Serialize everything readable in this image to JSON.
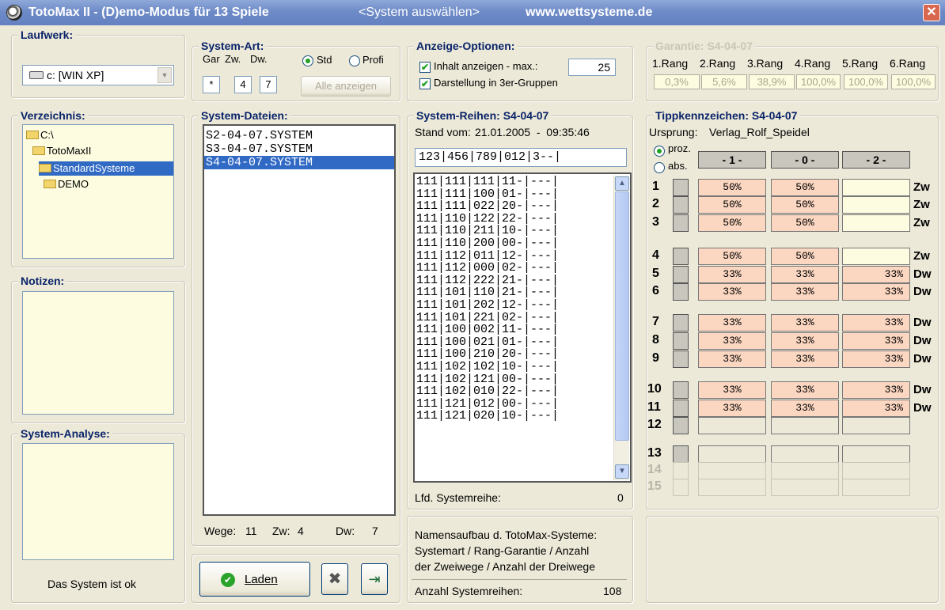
{
  "window": {
    "title": "TotoMax II - (D)emo-Modus für 13 Spiele",
    "system_prompt": "<System auswählen>",
    "website": "www.wettsysteme.de",
    "close": "✕"
  },
  "laufwerk": {
    "legend": "Laufwerk:",
    "drive": "c: [WIN XP]"
  },
  "verzeichnis": {
    "legend": "Verzeichnis:",
    "items": [
      "C:\\",
      "TotoMaxII",
      "StandardSysteme",
      "DEMO"
    ]
  },
  "notizen": {
    "legend": "Notizen:"
  },
  "analyse": {
    "legend": "System-Analyse:",
    "status": "Das System ist ok"
  },
  "system_art": {
    "legend": "System-Art:",
    "col_gar": "Gar",
    "col_zw": "Zw.",
    "col_dw": "Dw.",
    "gar_value": "*",
    "zw_value": "4",
    "dw_value": "7",
    "radio_std": "Std",
    "radio_profi": "Profi",
    "alle_button": "Alle anzeigen"
  },
  "dateien": {
    "legend": "System-Dateien:",
    "files": [
      "S2-04-07.SYSTEM",
      "S3-04-07.SYSTEM",
      "S4-04-07.SYSTEM"
    ],
    "wege_label": "Wege:",
    "wege": "11",
    "zw_label": "Zw:",
    "zw": "4",
    "dw_label": "Dw:",
    "dw": "7"
  },
  "buttons": {
    "laden": "Laden"
  },
  "anzeige": {
    "legend": "Anzeige-Optionen:",
    "inhalt_label": "Inhalt anzeigen - max.:",
    "max_value": "25",
    "gruppen_label": "Darstellung in 3er-Gruppen"
  },
  "reihen": {
    "legend": "System-Reihen: S4-04-07",
    "stand_label": "Stand vom:",
    "stand_value": "21.01.2005  -  09:35:46",
    "header": "123|456|789|012|3--|",
    "rows": [
      "111|111|111|11-|---|",
      "111|111|100|01-|---|",
      "111|111|022|20-|---|",
      "111|110|122|22-|---|",
      "111|110|211|10-|---|",
      "111|110|200|00-|---|",
      "111|112|011|12-|---|",
      "111|112|000|02-|---|",
      "111|112|222|21-|---|",
      "111|101|110|21-|---|",
      "111|101|202|12-|---|",
      "111|101|221|02-|---|",
      "111|100|002|11-|---|",
      "111|100|021|01-|---|",
      "111|100|210|20-|---|",
      "111|102|102|10-|---|",
      "111|102|121|00-|---|",
      "111|102|010|22-|---|",
      "111|121|012|00-|---|",
      "111|121|020|10-|---|"
    ],
    "lfd_label": "Lfd. Systemreihe:",
    "lfd_value": "0"
  },
  "info": {
    "line1": "Namensaufbau d. TotoMax-Systeme:",
    "line2": "Systemart / Rang-Garantie / Anzahl",
    "line3": "der Zweiwege / Anzahl der Dreiwege",
    "anzahl_label": "Anzahl Systemreihen:",
    "anzahl_value": "108"
  },
  "garantie": {
    "legend": "Garantie: S4-04-07",
    "ranks": [
      "1.Rang",
      "2.Rang",
      "3.Rang",
      "4.Rang",
      "5.Rang",
      "6.Rang"
    ],
    "values": [
      "0,3%",
      "5,6%",
      "38,9%",
      "100,0%",
      "100,0%",
      "100,0%"
    ]
  },
  "tipp": {
    "legend": "Tippkennzeichen: S4-04-07",
    "ursprung_label": "Ursprung:",
    "ursprung_value": "Verlag_Rolf_Speidel",
    "radio_proz": "proz.",
    "radio_abs": "abs.",
    "col_1": "- 1 -",
    "col_0": "- 0 -",
    "col_2": "- 2 -",
    "rows": [
      {
        "n": "1",
        "a": "50%",
        "b": "50%",
        "c": "",
        "t": "Zw"
      },
      {
        "n": "2",
        "a": "50%",
        "b": "50%",
        "c": "",
        "t": "Zw"
      },
      {
        "n": "3",
        "a": "50%",
        "b": "50%",
        "c": "",
        "t": "Zw"
      },
      {
        "n": "4",
        "a": "50%",
        "b": "50%",
        "c": "",
        "t": "Zw"
      },
      {
        "n": "5",
        "a": "33%",
        "b": "33%",
        "c": "33%",
        "t": "Dw"
      },
      {
        "n": "6",
        "a": "33%",
        "b": "33%",
        "c": "33%",
        "t": "Dw"
      },
      {
        "n": "7",
        "a": "33%",
        "b": "33%",
        "c": "33%",
        "t": "Dw"
      },
      {
        "n": "8",
        "a": "33%",
        "b": "33%",
        "c": "33%",
        "t": "Dw"
      },
      {
        "n": "9",
        "a": "33%",
        "b": "33%",
        "c": "33%",
        "t": "Dw"
      },
      {
        "n": "10",
        "a": "33%",
        "b": "33%",
        "c": "33%",
        "t": "Dw"
      },
      {
        "n": "11",
        "a": "33%",
        "b": "33%",
        "c": "33%",
        "t": "Dw"
      },
      {
        "n": "12",
        "a": "",
        "b": "",
        "c": "",
        "t": ""
      },
      {
        "n": "13",
        "a": "",
        "b": "",
        "c": "",
        "t": ""
      },
      {
        "n": "14",
        "a": "",
        "b": "",
        "c": "",
        "t": ""
      },
      {
        "n": "15",
        "a": "",
        "b": "",
        "c": "",
        "t": ""
      }
    ]
  }
}
